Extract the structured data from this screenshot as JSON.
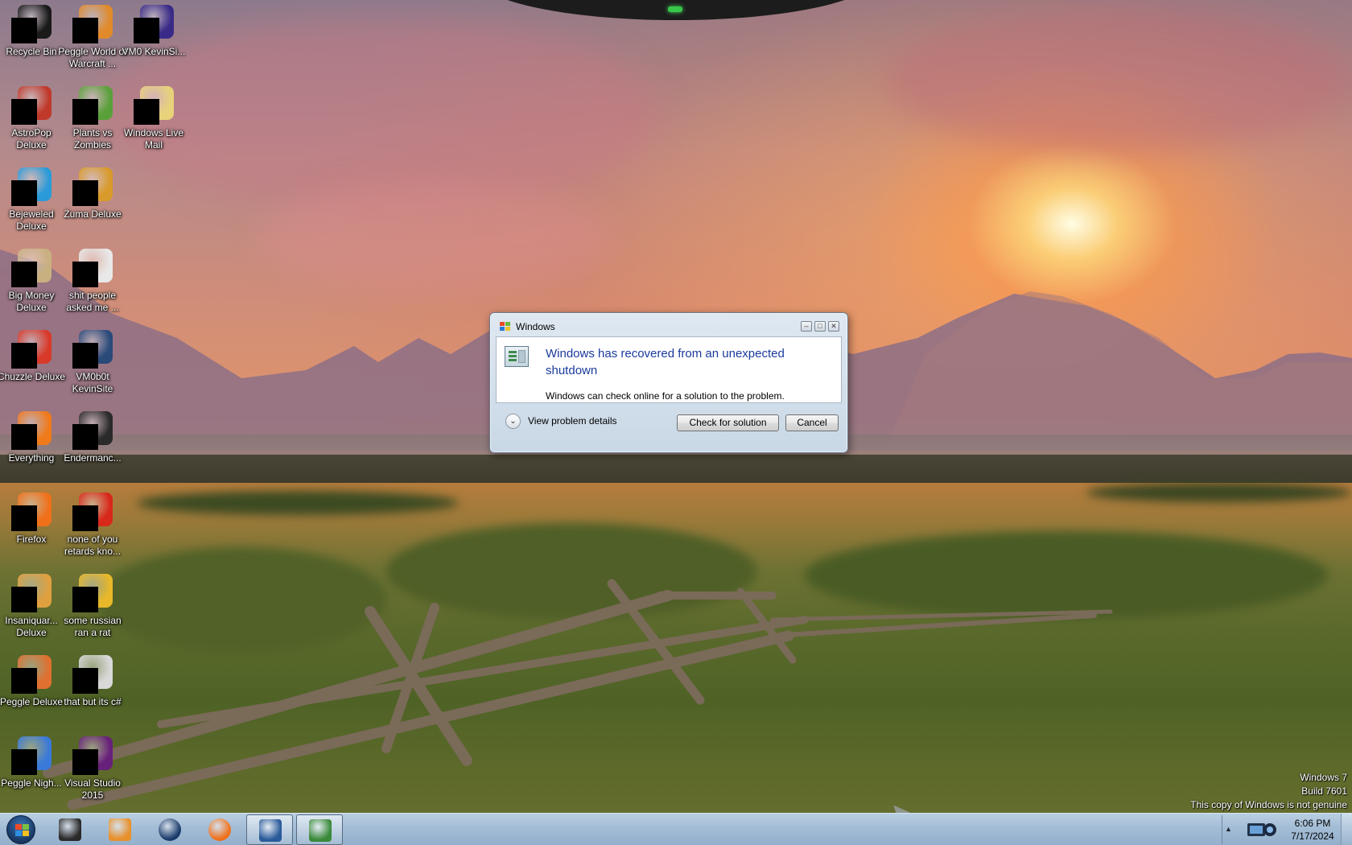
{
  "desktop": {
    "icons": [
      {
        "name": "recycle-bin",
        "label": "Recycle Bin",
        "color": "#1a1a1a"
      },
      {
        "name": "peggle-world-of-warcraft",
        "label": "Peggle World of Warcraft ...",
        "color": "#e08a2a"
      },
      {
        "name": "vm0-kevinsite",
        "label": "VM0 KevinSi...",
        "color": "#3a2a88"
      },
      {
        "name": "astropop-deluxe",
        "label": "AstroPop Deluxe",
        "color": "#c0392b"
      },
      {
        "name": "plants-vs-zombies",
        "label": "Plants vs Zombies",
        "color": "#5aa03a"
      },
      {
        "name": "windows-live-mail",
        "label": "Windows Live Mail",
        "color": "#e8d27a"
      },
      {
        "name": "bejeweled-deluxe",
        "label": "Bejeweled Deluxe",
        "color": "#2a9ad8"
      },
      {
        "name": "zuma-deluxe",
        "label": "Zuma Deluxe",
        "color": "#d89a2a"
      },
      {
        "name": "big-money-deluxe",
        "label": "Big Money Deluxe",
        "color": "#c8b080"
      },
      {
        "name": "shit-people-asked-me",
        "label": "shit people asked me ...",
        "color": "#e8e8e8"
      },
      {
        "name": "chuzzle-deluxe",
        "label": "Chuzzle Deluxe",
        "color": "#d83a2a"
      },
      {
        "name": "vm0b0t-kevinsite",
        "label": "VM0b0t KevinSite",
        "color": "#2a4a7a"
      },
      {
        "name": "everything",
        "label": "Everything",
        "color": "#f07a1a"
      },
      {
        "name": "endermanch",
        "label": "Endermanc...",
        "color": "#2a2a2a"
      },
      {
        "name": "firefox",
        "label": "Firefox",
        "color": "#f0701a"
      },
      {
        "name": "none-of-you-retards-know",
        "label": "none of you retards kno...",
        "color": "#d8281a"
      },
      {
        "name": "insaniquarium-deluxe",
        "label": "Insaniquar... Deluxe",
        "color": "#e0a040"
      },
      {
        "name": "some-russian-ran-a-rat",
        "label": "some russian ran a rat",
        "color": "#e8b82a"
      },
      {
        "name": "peggle-deluxe",
        "label": "Peggle Deluxe",
        "color": "#e07030"
      },
      {
        "name": "that-but-its-csharp",
        "label": "that but its c#",
        "color": "#d8d8d8"
      },
      {
        "name": "peggle-nights",
        "label": "Peggle Nigh...",
        "color": "#3a7ad8"
      },
      {
        "name": "visual-studio-2015",
        "label": "Visual Studio 2015",
        "color": "#68217a"
      }
    ]
  },
  "dialog": {
    "title": "Windows",
    "main_instruction": "Windows has recovered from an unexpected shutdown",
    "content": "Windows can check online for a solution to the problem.",
    "details_label": "View problem details",
    "primary_button": "Check for solution",
    "cancel_button": "Cancel",
    "minimize_glyph": "–",
    "maximize_glyph": "□",
    "close_glyph": "✕",
    "chevron_glyph": "⌄"
  },
  "watermark": {
    "line1": "Windows 7",
    "line2": "Build 7601",
    "line3": "This copy of Windows is not genuine"
  },
  "taskbar": {
    "pinned": [
      {
        "name": "taskbar-app-1",
        "icon": "monitor-icon",
        "color": "#2a2a2a"
      },
      {
        "name": "taskbar-media-player",
        "icon": "media-player-icon",
        "color": "#e8902a"
      },
      {
        "name": "taskbar-app-3",
        "icon": "globe-icon",
        "color": "#1a3a6a"
      },
      {
        "name": "taskbar-firefox",
        "icon": "firefox-icon",
        "color": "#f0701a"
      },
      {
        "name": "taskbar-remote-desktop",
        "icon": "remote-desktop-icon",
        "color": "#2a5a9a"
      },
      {
        "name": "taskbar-windows-dialog",
        "icon": "checklist-icon",
        "color": "#3a8a3a"
      }
    ],
    "tray_arrow": "▲",
    "clock": {
      "time": "6:06 PM",
      "date": "7/17/2024"
    }
  }
}
